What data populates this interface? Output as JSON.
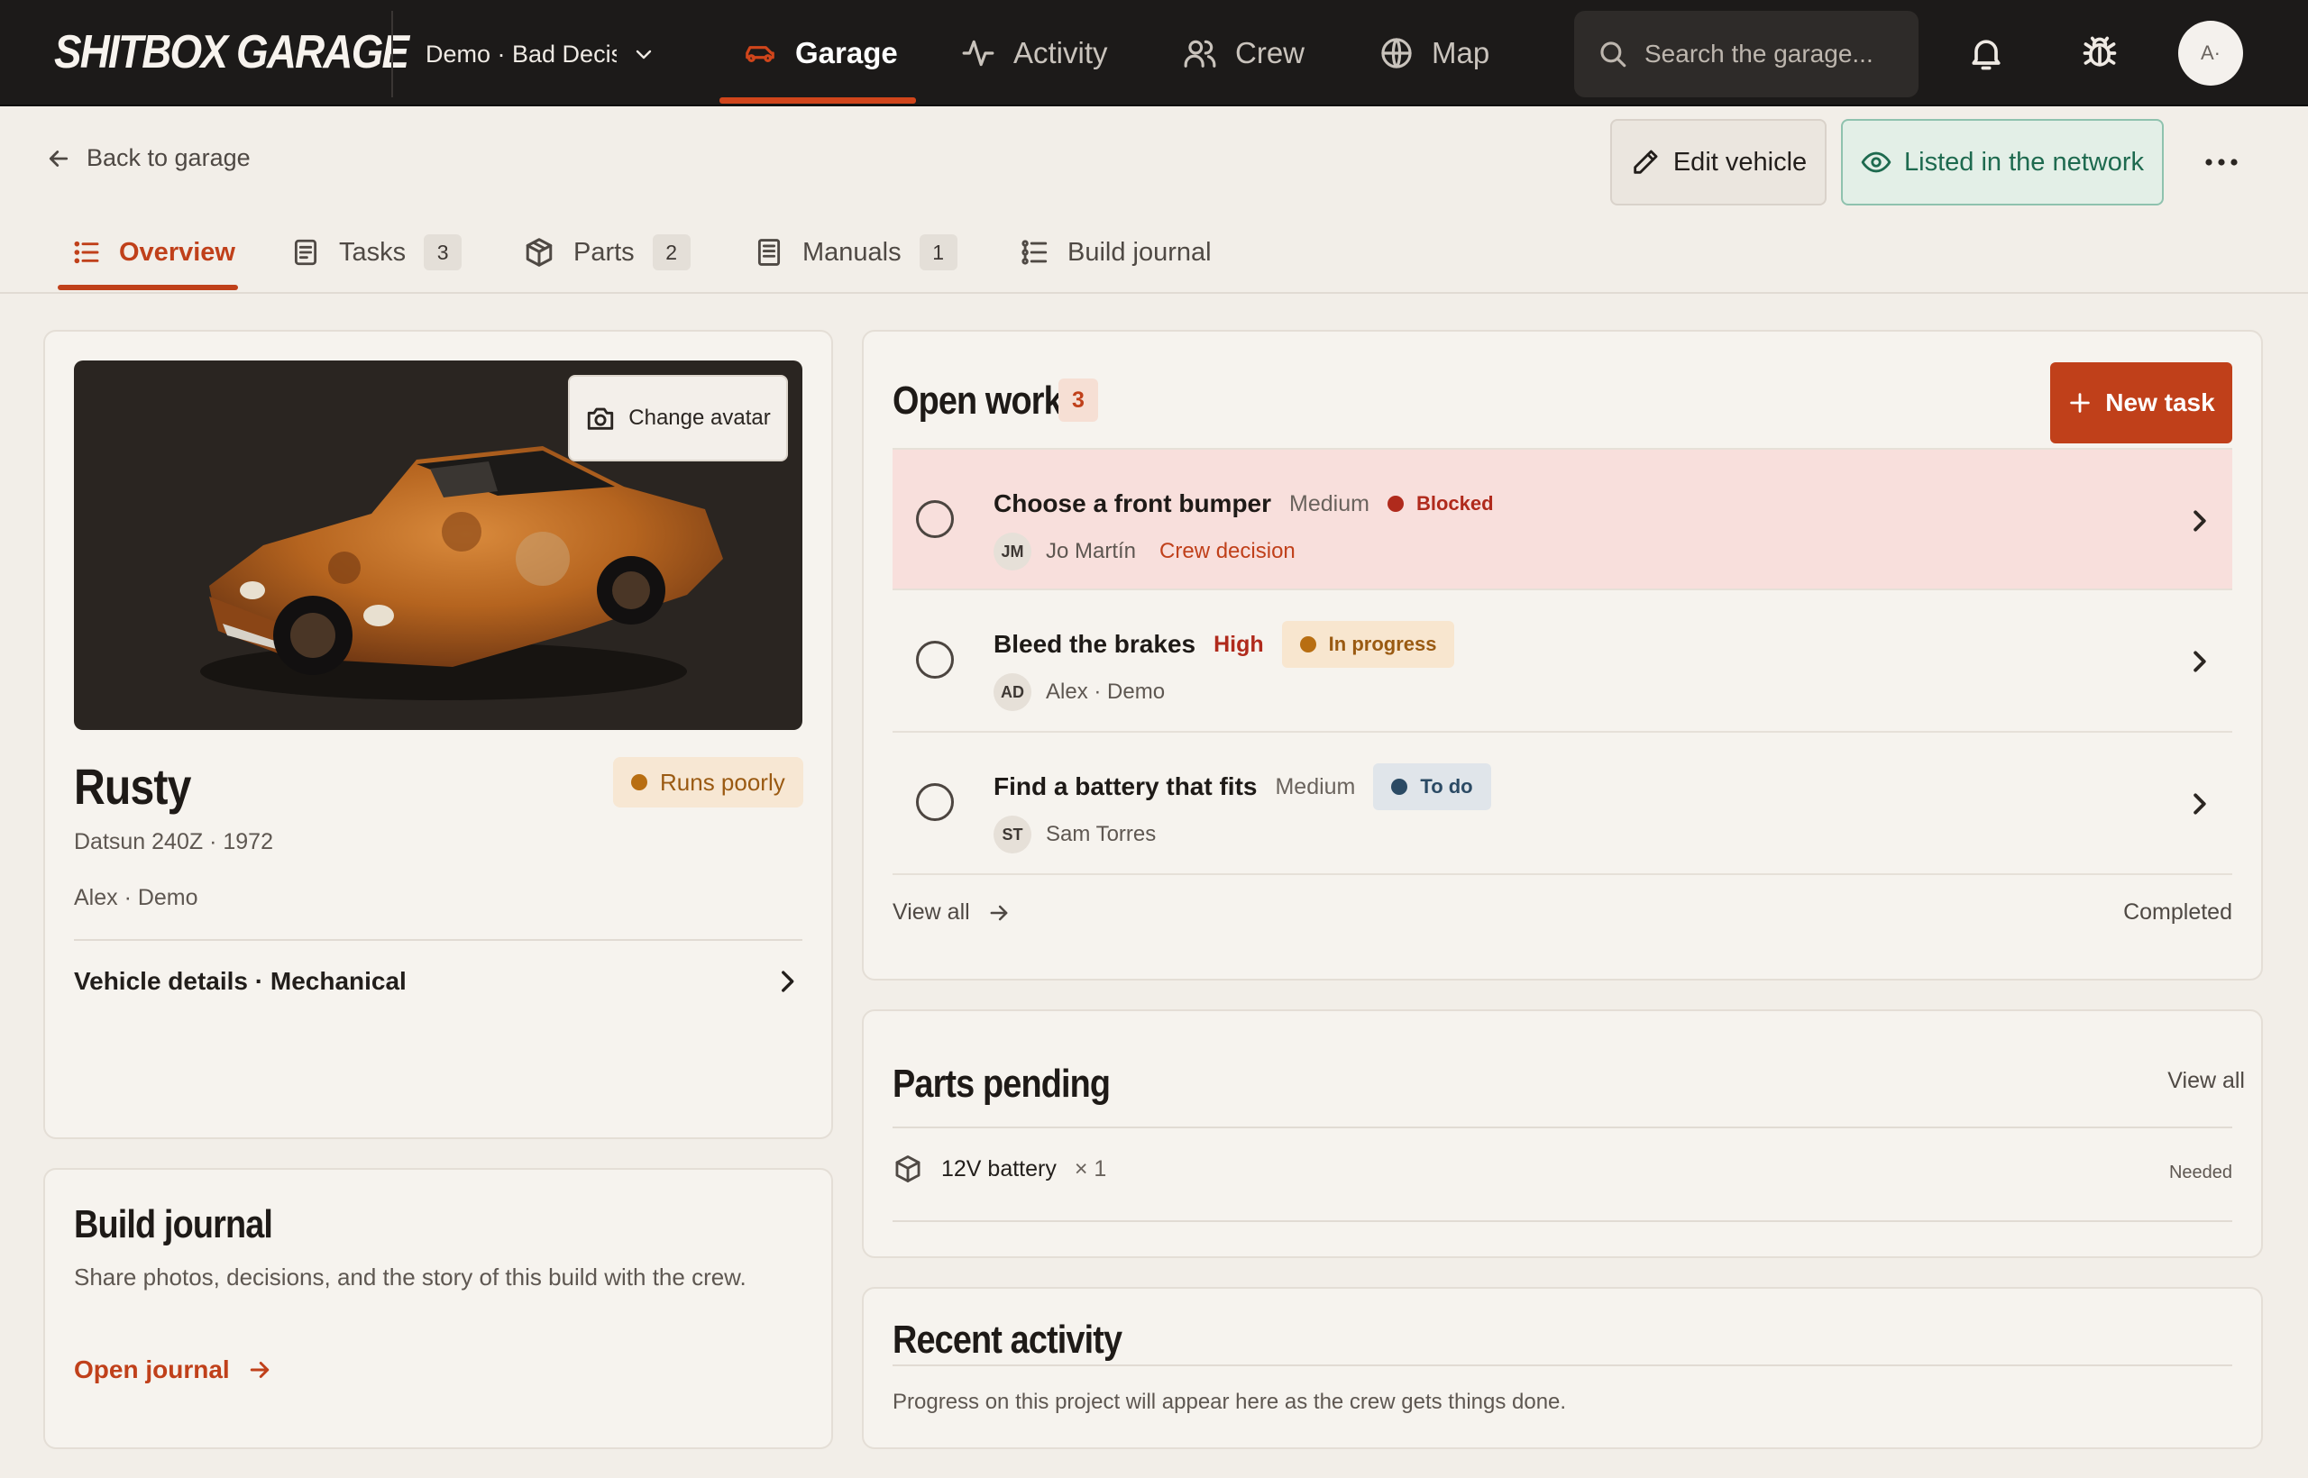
{
  "app": {
    "logo": "SHITBOX GARAGE",
    "workspace": "Demo · Bad Decis",
    "search_placeholder": "Search the garage...",
    "avatar_initials": "A·"
  },
  "nav": [
    {
      "label": "Garage",
      "icon": "car-icon",
      "active": true
    },
    {
      "label": "Activity",
      "icon": "activity-icon",
      "active": false
    },
    {
      "label": "Crew",
      "icon": "users-icon",
      "active": false
    },
    {
      "label": "Map",
      "icon": "globe-icon",
      "active": false
    }
  ],
  "header": {
    "back_label": "Back to garage",
    "edit_label": "Edit vehicle",
    "listed_label": "Listed in the network"
  },
  "tabs": [
    {
      "label": "Overview",
      "icon": "list-icon",
      "active": true
    },
    {
      "label": "Tasks",
      "count": "3",
      "icon": "clipboard-icon"
    },
    {
      "label": "Parts",
      "count": "2",
      "icon": "box-icon"
    },
    {
      "label": "Manuals",
      "count": "1",
      "icon": "book-icon"
    },
    {
      "label": "Build journal",
      "icon": "journal-icon"
    }
  ],
  "vehicle": {
    "name": "Rusty",
    "status": "Runs poorly",
    "model": "Datsun 240Z · 1972",
    "owner": "Alex · Demo",
    "change_avatar_label": "Change avatar",
    "details_label": "Vehicle details · Mechanical"
  },
  "journal": {
    "title": "Build journal",
    "description": "Share photos, decisions, and the story of this build with the crew.",
    "link_label": "Open journal"
  },
  "open_work": {
    "title": "Open work",
    "count": "3",
    "new_task_label": "New task",
    "view_all_label": "View all",
    "completed_label": "Completed",
    "tasks": [
      {
        "title": "Choose a front bumper",
        "priority": "Medium",
        "status": "Blocked",
        "assignee_initials": "JM",
        "assignee": "Jo Martín",
        "tag": "Crew decision"
      },
      {
        "title": "Bleed the brakes",
        "priority": "High",
        "status": "In progress",
        "assignee_initials": "AD",
        "assignee": "Alex · Demo"
      },
      {
        "title": "Find a battery that fits",
        "priority": "Medium",
        "status": "To do",
        "assignee_initials": "ST",
        "assignee": "Sam Torres"
      }
    ]
  },
  "parts": {
    "title": "Parts pending",
    "view_all_label": "View all",
    "items": [
      {
        "name": "12V battery",
        "qty": "× 1",
        "status": "Needed"
      }
    ]
  },
  "activity": {
    "title": "Recent activity",
    "description": "Progress on this project will appear here as the crew gets things done."
  },
  "colors": {
    "accent": "#c0401a",
    "topbar": "#1c1a19",
    "blocked": "#b02a1c",
    "in_progress": "#b86e12",
    "todo": "#2b4a64",
    "listed": "#1e6a4f"
  }
}
